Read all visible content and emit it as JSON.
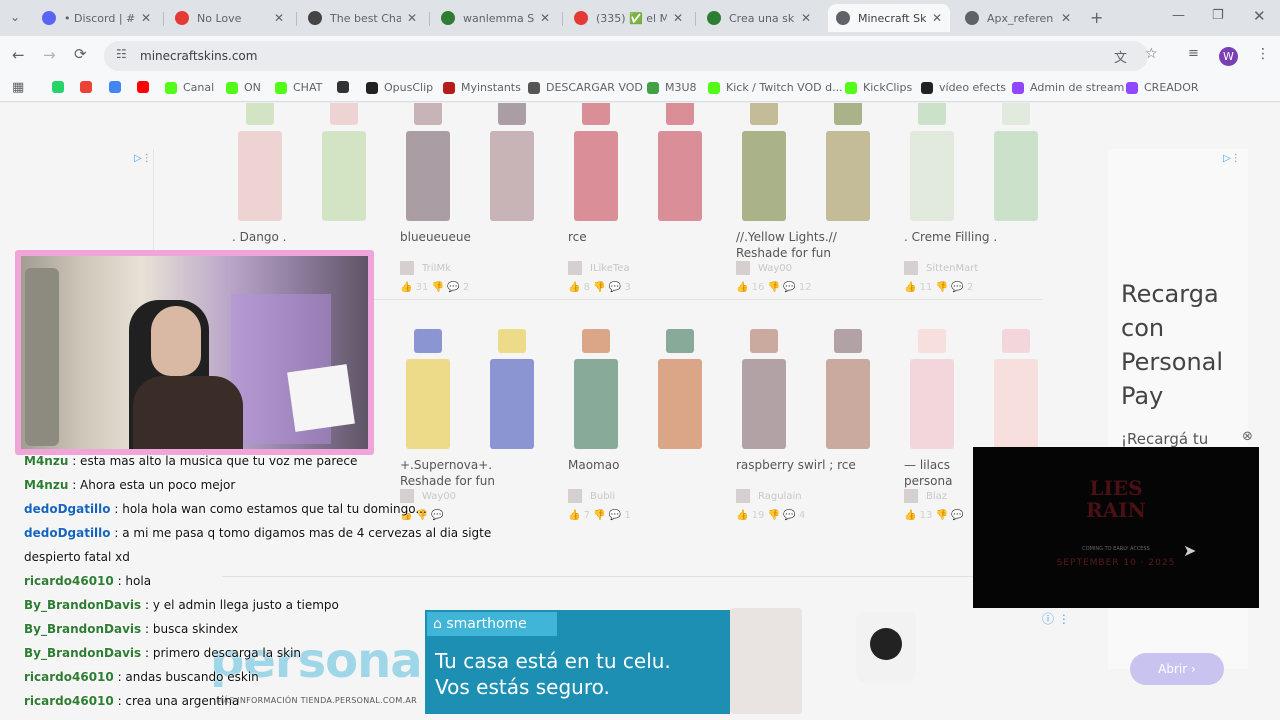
{
  "browser": {
    "tabs": [
      {
        "title": "• Discord | #",
        "favicon_color": "#5865f2",
        "active": false
      },
      {
        "title": "No Love",
        "favicon_color": "#e53935",
        "active": false
      },
      {
        "title": "The best Chat",
        "favicon_color": "#444444",
        "active": false
      },
      {
        "title": "wanlemma St",
        "favicon_color": "#2e7d32",
        "active": false
      },
      {
        "title": "(335) ✅ el MI",
        "favicon_color": "#e53935",
        "active": false
      },
      {
        "title": "Crea una skin",
        "favicon_color": "#2e7d32",
        "active": false
      },
      {
        "title": "Minecraft Skin",
        "favicon_color": "#5f6368",
        "active": true
      },
      {
        "title": "Apx_referen",
        "favicon_color": "#5f6368",
        "active": false
      }
    ],
    "new_tab": "+",
    "url": "minecraftskins.com",
    "profile_initial": "W",
    "bookmarks": [
      {
        "label": "",
        "icon": "whatsapp-icon",
        "color": "#25d366"
      },
      {
        "label": "",
        "icon": "maps-icon",
        "color": "#ea4335"
      },
      {
        "label": "",
        "icon": "chrome-icon",
        "color": "#4285f4"
      },
      {
        "label": "",
        "icon": "youtube-icon",
        "color": "#ff0000"
      },
      {
        "label": "Canal",
        "icon": "kick-icon",
        "color": "#53fc18"
      },
      {
        "label": "ON",
        "icon": "kick-icon",
        "color": "#53fc18"
      },
      {
        "label": "CHAT",
        "icon": "kick-icon",
        "color": "#53fc18"
      },
      {
        "label": "",
        "icon": "app-icon",
        "color": "#333333"
      },
      {
        "label": "OpusClip",
        "icon": "opus-icon",
        "color": "#222222"
      },
      {
        "label": "Myinstants",
        "icon": "myinstants-icon",
        "color": "#b71c1c"
      },
      {
        "label": "DESCARGAR VOD",
        "icon": "gear-icon",
        "color": "#555555"
      },
      {
        "label": "M3U8",
        "icon": "check-icon",
        "color": "#43a047"
      },
      {
        "label": "Kick / Twitch VOD d...",
        "icon": "kick-icon",
        "color": "#53fc18"
      },
      {
        "label": "KickClips",
        "icon": "kick-icon",
        "color": "#53fc18"
      },
      {
        "label": "vídeo efects",
        "icon": "video-icon",
        "color": "#222222"
      },
      {
        "label": "Admin de stream",
        "icon": "twitch-icon",
        "color": "#9146ff"
      },
      {
        "label": "CREADOR",
        "icon": "twitch-icon",
        "color": "#9146ff"
      }
    ]
  },
  "skins_row1": [
    {
      "name": ". Dango .",
      "author": "",
      "likes": "",
      "comments": "",
      "colors": [
        "#e8b7b7",
        "#b7d59a"
      ]
    },
    {
      "name": "blueueueue",
      "author": "TriIMk",
      "likes": "31",
      "comments": "2",
      "colors": [
        "#6b5560",
        "#a37b84"
      ]
    },
    {
      "name": "rce",
      "author": "ILikeTea",
      "likes": "8",
      "comments": "3",
      "colors": [
        "#c23a4a",
        "#c23a4a"
      ]
    },
    {
      "name": "//.Yellow Lights.//\nReshade for fun",
      "author": "Way00",
      "likes": "16",
      "comments": "12",
      "colors": [
        "#6b7a2f",
        "#9a8a4a"
      ]
    },
    {
      "name": ". Creme Filling .",
      "author": "SittenMart",
      "likes": "11",
      "comments": "2",
      "colors": [
        "#cfe0c7",
        "#a7cfa4"
      ]
    }
  ],
  "skins_row2": [
    {
      "name": "+.Supernova+.\nReshade for fun",
      "author": "Way00",
      "likes": "",
      "comments": "",
      "colors": [
        "#e8c531",
        "#3146b5"
      ]
    },
    {
      "name": "Maomao",
      "author": "Bubli",
      "likes": "7",
      "comments": "1",
      "colors": [
        "#2e6b4d",
        "#c4632c"
      ]
    },
    {
      "name": "raspberry swirl ; rce",
      "author": "Ragulain",
      "likes": "19",
      "comments": "4",
      "colors": [
        "#7a5b62",
        "#a56a55"
      ]
    },
    {
      "name": "— lilacs\npersona",
      "author": "Blaz",
      "likes": "13",
      "comments": "",
      "colors": [
        "#f0b9c6",
        "#f6ccc8"
      ]
    }
  ],
  "side_ad": {
    "title": "Recarga con Personal Pay",
    "text": "¡Recargá tu línea desde la app te",
    "button": "Abrir"
  },
  "bottom_banner": {
    "brand_left": "personal",
    "footer": "MÁS INFORMACIÓN TIENDA.PERSONAL.COM.AR",
    "tag": "smarthome",
    "headline1": "Tu casa está en tu celu.",
    "headline2": "Vos estás seguro."
  },
  "popup_video": {
    "title_line1": "LIES",
    "title_line2": "RAIN",
    "subtitle": "COMING TO EARLY ACCESS",
    "date": "SEPTEMBER 10 · 2025"
  },
  "chat": [
    {
      "user": "M4nzu",
      "color": "#2e7d32",
      "text": ": esta mas alto la musica que tu voz me parece"
    },
    {
      "user": "M4nzu",
      "color": "#2e7d32",
      "text": ": Ahora esta un poco mejor"
    },
    {
      "user": "dedoDgatillo",
      "color": "#1565c0",
      "text": ": hola hola wan como estamos que tal tu domingo..."
    },
    {
      "user": "dedoDgatillo",
      "color": "#1565c0",
      "text": ": a mi me pasa q tomo digamos mas de 4 cervezas al dia sigte"
    },
    {
      "user": "",
      "color": "#111111",
      "text": "despierto fatal xd"
    },
    {
      "user": "ricardo46010",
      "color": "#2e7d32",
      "text": ": hola"
    },
    {
      "user": "By_BrandonDavis",
      "color": "#2e7d32",
      "text": ": y el admin llega justo a tiempo"
    },
    {
      "user": "By_BrandonDavis",
      "color": "#2e7d32",
      "text": ": busca skindex"
    },
    {
      "user": "By_BrandonDavis",
      "color": "#2e7d32",
      "text": ": primero descarga la skin"
    },
    {
      "user": "ricardo46010",
      "color": "#2e7d32",
      "text": ": andas buscando eskin"
    },
    {
      "user": "ricardo46010",
      "color": "#2e7d32",
      "text": ": crea una argentina"
    }
  ]
}
